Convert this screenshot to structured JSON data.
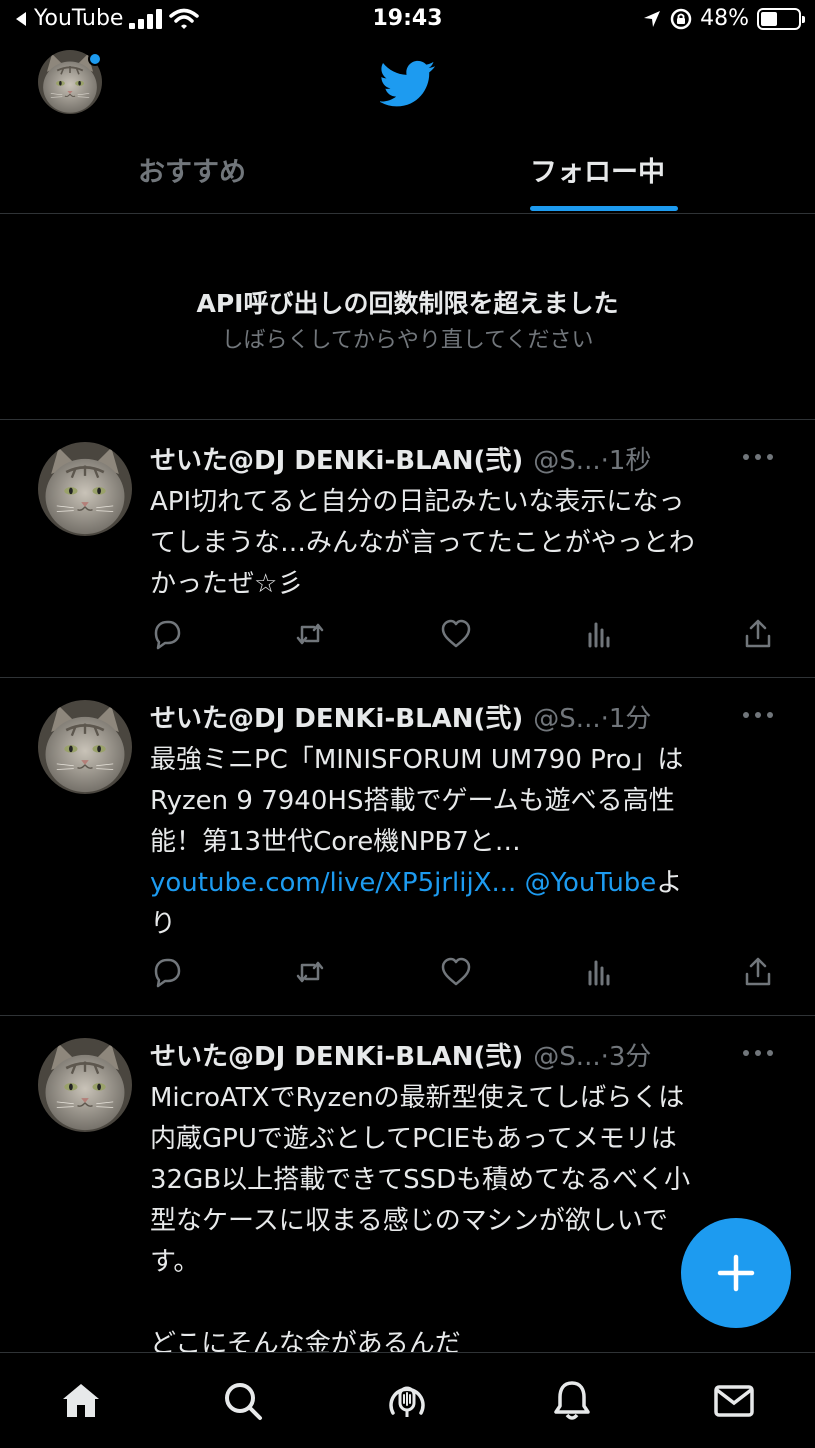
{
  "status_bar": {
    "back_app": "YouTube",
    "time": "19:43",
    "battery": "48%"
  },
  "header": {
    "logo": "twitter-bird-icon",
    "tabs": [
      {
        "label": "おすすめ",
        "active": false
      },
      {
        "label": "フォロー中",
        "active": true
      }
    ]
  },
  "notice": {
    "title": "API呼び出しの回数制限を超えました",
    "subtitle": "しばらくしてからやり直してください"
  },
  "tweets": [
    {
      "name": "せいた@DJ DENKi-BLAN(弐)",
      "handle": "@S...",
      "time": "·1秒",
      "lines": [
        "API切れてると自分の日記みたいな表示になっ",
        "てしまうな…みんなが言ってたことがやっとわ",
        "かったぜ☆彡"
      ]
    },
    {
      "name": "せいた@DJ DENKi-BLAN(弐)",
      "handle": "@S...",
      "time": "·1分",
      "lines": [
        "最強ミニPC「MINISFORUM UM790 Pro」は",
        "Ryzen 9 7940HS搭載でゲームも遊べる高性",
        "能！第13世代Core機NPB7と…"
      ],
      "link": "youtube.com/live/XP5jrlijX...",
      "mention": "@YouTube",
      "suffix_1": "よ",
      "suffix_2": "り"
    },
    {
      "name": "せいた@DJ DENKi-BLAN(弐)",
      "handle": "@S...",
      "time": "·3分",
      "lines": [
        "MicroATXでRyzenの最新型使えてしばらくは",
        "内蔵GPUで遊ぶとしてPCIEもあってメモリは",
        "32GB以上搭載できてSSDも積めてなるべく小",
        "型なケースに収まる感じのマシンが欲しいで",
        "す。",
        "",
        "どこにそんな金があるんだ"
      ]
    }
  ],
  "tweet_actions": [
    "reply-icon",
    "retweet-icon",
    "like-icon",
    "views-icon",
    "share-icon"
  ],
  "bottom_nav": [
    "home-icon",
    "search-icon",
    "spaces-icon",
    "notifications-icon",
    "messages-icon"
  ],
  "fab": "compose-plus-icon",
  "colors": {
    "accent": "#1d9bf0",
    "background": "#000000",
    "text": "#e7e9ea",
    "muted": "#71767b",
    "divider": "#2f3336"
  }
}
